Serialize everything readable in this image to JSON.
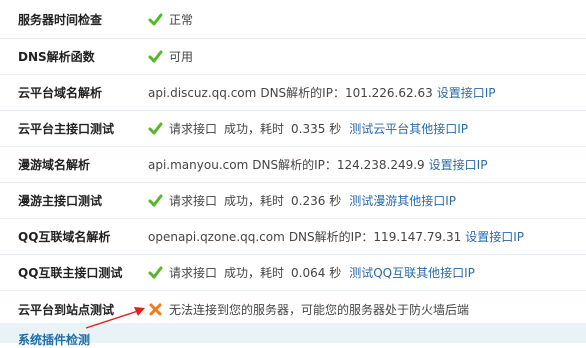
{
  "rows": [
    {
      "label": "服务器时间检查",
      "icon": "check-icon",
      "status": "正常"
    },
    {
      "label": "DNS解析函数",
      "icon": "check-icon",
      "status": "可用"
    },
    {
      "label": "云平台域名解析",
      "domain": "api.discuz.qq.com",
      "dns_text": "DNS解析的IP：101.226.62.63",
      "link": "设置接口IP"
    },
    {
      "label": "云平台主接口测试",
      "icon": "check-icon",
      "req": "请求接口",
      "ok": "成功，耗时",
      "time": "0.335 秒",
      "link": "测试云平台其他接口IP"
    },
    {
      "label": "漫游域名解析",
      "domain": "api.manyou.com",
      "dns_text": "DNS解析的IP：124.238.249.9",
      "link": "设置接口IP"
    },
    {
      "label": "漫游主接口测试",
      "icon": "check-icon",
      "req": "请求接口",
      "ok": "成功，耗时",
      "time": "0.236 秒",
      "link": "测试漫游其他接口IP"
    },
    {
      "label": "QQ互联域名解析",
      "domain": "openapi.qzone.qq.com",
      "dns_text": "DNS解析的IP：119.147.79.31",
      "link": "设置接口IP"
    },
    {
      "label": "QQ互联主接口测试",
      "icon": "check-icon",
      "req": "请求接口",
      "ok": "成功，耗时",
      "time": "0.064 秒",
      "link": "测试QQ互联其他接口IP"
    },
    {
      "label": "云平台到站点测试",
      "icon": "cross-icon",
      "status": "无法连接到您的服务器，可能您的服务器处于防火墙后端"
    }
  ],
  "footer": {
    "title": "系统插件检测"
  },
  "colors": {
    "check": "#52b824",
    "cross": "#f07c1c",
    "link": "#2b6aa8",
    "arrow": "#e02020"
  }
}
